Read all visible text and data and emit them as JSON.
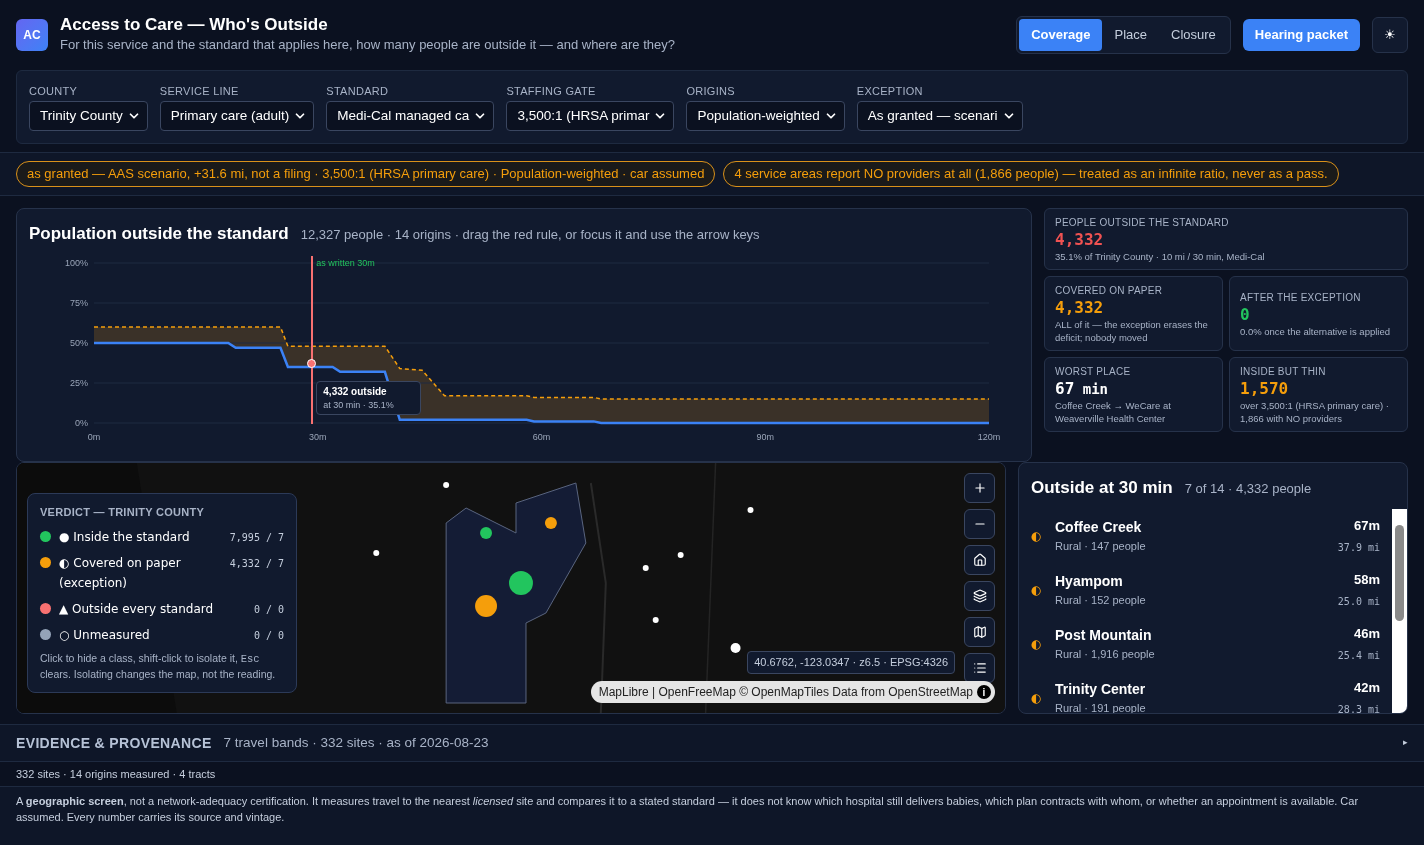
{
  "app": {
    "logo": "AC",
    "title": "Access to Care — Who's Outside",
    "subtitle": "For this service and the standard that applies here, how many people are outside it — and where are they?"
  },
  "view_tabs": [
    {
      "label": "Coverage",
      "selected": true
    },
    {
      "label": "Place",
      "selected": false
    },
    {
      "label": "Closure",
      "selected": false
    }
  ],
  "hearing_button": "Hearing packet",
  "theme_button": "☀",
  "filters": [
    {
      "label": "COUNTY",
      "value": "Trinity County"
    },
    {
      "label": "SERVICE LINE",
      "value": "Primary care (adult)"
    },
    {
      "label": "STANDARD",
      "value": "Medi-Cal managed ca"
    },
    {
      "label": "STAFFING GATE",
      "value": "3,500:1 (HRSA primar"
    },
    {
      "label": "ORIGINS",
      "value": "Population-weighted"
    },
    {
      "label": "EXCEPTION",
      "value": "As granted — scenari"
    }
  ],
  "banners": [
    "as granted — AAS scenario, +31.6 mi, not a filing · 3,500:1 (HRSA primary care) · Population-weighted · car assumed",
    "4 service areas report NO providers at all (1,866 people) — treated as an infinite ratio, never as a pass."
  ],
  "chart_panel": {
    "title": "Population outside the standard",
    "meta": "12,327 people · 14 origins · drag the red rule, or focus it and use the arrow keys",
    "rule_label": "as written 30m",
    "tooltip_title": "4,332 outside",
    "tooltip_sub": "at 30 min · 35.1%",
    "chart_data": {
      "type": "line",
      "grid": true,
      "x": [
        0,
        18,
        19,
        25,
        26,
        32,
        33,
        39,
        41,
        44,
        47,
        58,
        59,
        67,
        68,
        120
      ],
      "xlim": [
        0,
        120
      ],
      "ylim": [
        0,
        100
      ],
      "xticks": [
        {
          "value": 0,
          "label": "0m"
        },
        {
          "value": 30,
          "label": "30m"
        },
        {
          "value": 60,
          "label": "60m"
        },
        {
          "value": 90,
          "label": "90m"
        },
        {
          "value": 120,
          "label": "120m"
        }
      ],
      "yticks": [
        {
          "value": 0,
          "label": "0%"
        },
        {
          "value": 25,
          "label": "25%"
        },
        {
          "value": 50,
          "label": "50%"
        },
        {
          "value": 75,
          "label": "75%"
        },
        {
          "value": 100,
          "label": "100%"
        }
      ],
      "series": [
        {
          "color": "#3b82f6",
          "line_style": "solid",
          "values": [
            50,
            50,
            47,
            47,
            35,
            35,
            32,
            32,
            2,
            2,
            2,
            2,
            1,
            1,
            0,
            0
          ]
        },
        {
          "color": "#f59e0b",
          "line_style": "dashed",
          "values": [
            60,
            60,
            60,
            60,
            48,
            48,
            48,
            48,
            34,
            33,
            17,
            17,
            16,
            16,
            15,
            15
          ]
        }
      ]
    }
  },
  "stats": [
    {
      "label": "PEOPLE OUTSIDE THE STANDARD",
      "value": "4,332",
      "note": "35.1% of Trinity County · 10 mi / 30 min, Medi-Cal",
      "color": "#f05252",
      "wide": true
    },
    {
      "label": "COVERED ON PAPER",
      "value": "4,332",
      "note": "ALL of it — the exception erases the deficit; nobody moved",
      "color": "#f59e0b",
      "wide": false
    },
    {
      "label": "AFTER THE EXCEPTION",
      "value": "0",
      "note": "0.0% once the alternative is applied",
      "color": "#22c55e",
      "wide": false
    },
    {
      "label": "WORST PLACE",
      "value": "67",
      "unit": "min",
      "note": "Coffee Creek → WeCare at Weaverville Health Center",
      "color": "#ffffff",
      "wide": false
    },
    {
      "label": "INSIDE BUT THIN",
      "value": "1,570",
      "note": "over 3,500:1 (HRSA primary care) · 1,866 with NO providers",
      "color": "#f59e0b",
      "wide": false
    }
  ],
  "map": {
    "verdict_title": "VERDICT — TRINITY COUNTY",
    "legend": [
      {
        "label": "● Inside the standard",
        "count": "7,995 / 7",
        "color": "#22c55e"
      },
      {
        "label": "◐ Covered on paper (exception)",
        "count": "4,332 / 7",
        "color": "#f59e0b"
      },
      {
        "label": "▲ Outside every standard",
        "count": "0 / 0",
        "color": "#f87171"
      },
      {
        "label": "○ Unmeasured",
        "count": "0 / 0",
        "color": "#94a3b8"
      }
    ],
    "hint_before": "Click to hide a class, shift-click to isolate it, ",
    "hint_key": "Esc",
    "hint_after": " clears. Isolating changes the map, not the reading.",
    "coords": "40.6762, -123.0347 · z6.5 · EPSG:4326",
    "attribution": "MapLibre | OpenFreeMap © OpenMapTiles Data from OpenStreetMap",
    "info": "i"
  },
  "outside_list": {
    "title": "Outside at 30 min",
    "meta": "7 of 14 · 4,332 people",
    "items": [
      {
        "glyph": "◐",
        "name": "Coffee Creek",
        "sub": "Rural · 147 people",
        "time": "67m",
        "distance": "37.9 mi"
      },
      {
        "glyph": "◐",
        "name": "Hyampom",
        "sub": "Rural · 152 people",
        "time": "58m",
        "distance": "25.0 mi"
      },
      {
        "glyph": "◐",
        "name": "Post Mountain",
        "sub": "Rural · 1,916 people",
        "time": "46m",
        "distance": "25.4 mi"
      },
      {
        "glyph": "◐",
        "name": "Trinity Center",
        "sub": "Rural · 191 people",
        "time": "42m",
        "distance": "28.3 mi"
      }
    ]
  },
  "evidence": {
    "title": "EVIDENCE & PROVENANCE",
    "meta": "7 travel bands · 332 sites · as of 2026-08-23",
    "toggle": "▸",
    "expanded": false
  },
  "counts_line": "332 sites · 14 origins measured · 4 tracts",
  "footnote": "A **geographic screen**, not a network-adequacy certification. It measures travel to the nearest *licensed* site and compares it to a stated standard — it does not know which hospital still delivers babies, which plan contracts with whom, or whether an appointment is available. Car assumed. Every number carries its source and vintage."
}
